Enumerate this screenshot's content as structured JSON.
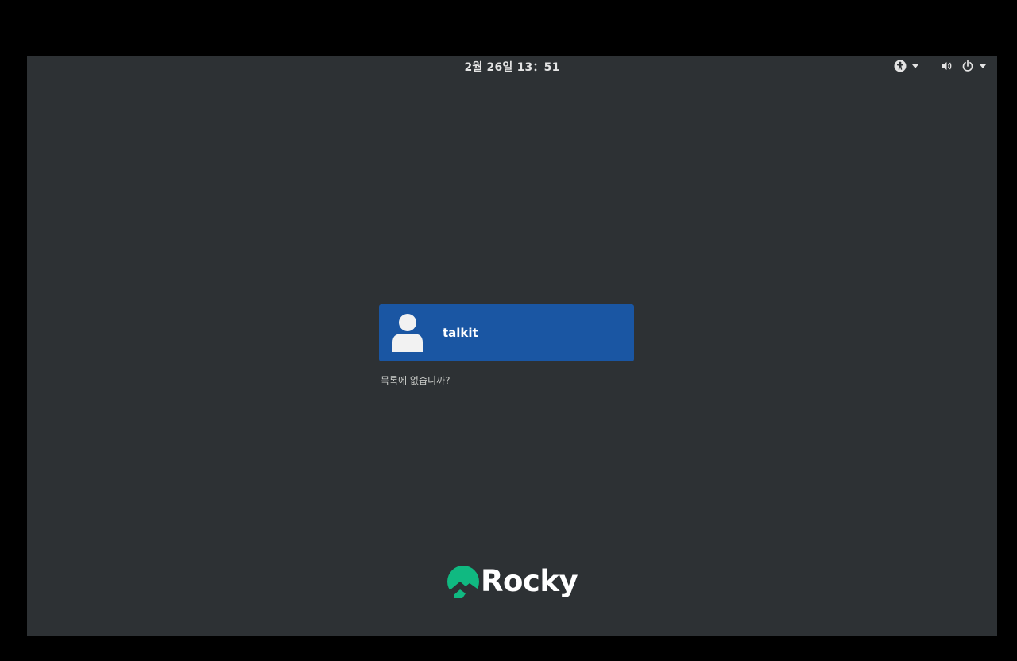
{
  "topbar": {
    "clock": "2월 26일  13：51",
    "icons": [
      "accessibility-icon",
      "volume-icon",
      "power-icon"
    ]
  },
  "login": {
    "users": [
      {
        "name": "talkit",
        "avatar": "user-silhouette-icon"
      }
    ],
    "not_listed": "목록에 없습니까?"
  },
  "branding": {
    "logo_text": "Rocky",
    "logo_color": "#10b981"
  },
  "colors": {
    "background": "#2d3134",
    "selected_user": "#1a56a3",
    "letterbox": "#000000"
  }
}
